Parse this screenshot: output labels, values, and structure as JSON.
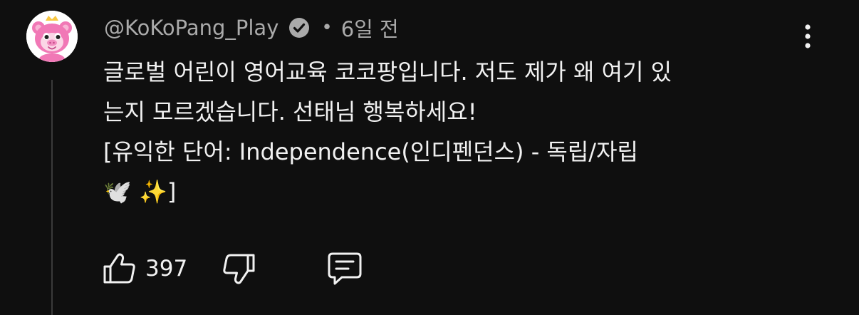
{
  "comment": {
    "author": "@KoKoPang_Play",
    "verified_icon": "verified-check-icon",
    "separator": "•",
    "time": "6일 전",
    "text": "글로벌 어린이 영어교육 코코팡입니다. 저도 제가 왜 여기 있\n는지 모르겠습니다. 선태님 행복하세요!\n[유익한 단어: Independence(인디펜던스) - 독립/자립\n🕊️ ✨]"
  },
  "actions": {
    "like_icon": "thumbs-up-icon",
    "like_count": "397",
    "dislike_icon": "thumbs-down-icon",
    "reply_icon": "comment-reply-icon"
  },
  "menu": {
    "icon": "more-vertical-icon"
  },
  "colors": {
    "background": "#0f0f0f",
    "text_primary": "#f1f1f1",
    "text_secondary": "#aaaaaa",
    "avatar_pink": "#f178b6"
  }
}
